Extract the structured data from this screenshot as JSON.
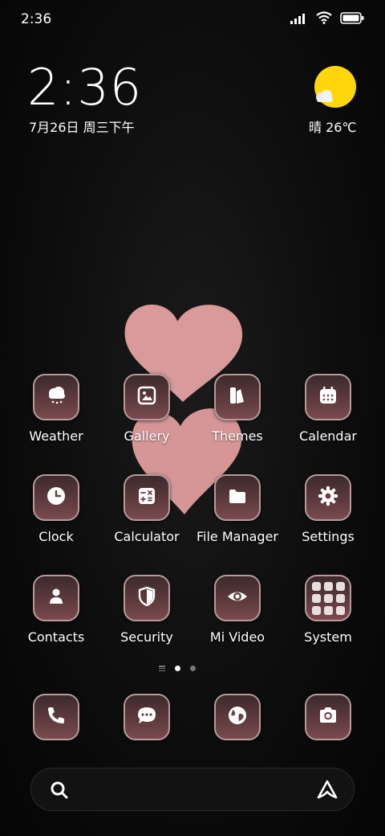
{
  "status_bar": {
    "time": "2:36"
  },
  "clock_widget": {
    "time": "2:36",
    "date": "7月26日 周三下午"
  },
  "weather_widget": {
    "text": "晴 26℃"
  },
  "apps": [
    {
      "label": "Weather",
      "icon": "weather-icon"
    },
    {
      "label": "Gallery",
      "icon": "gallery-icon"
    },
    {
      "label": "Themes",
      "icon": "themes-icon"
    },
    {
      "label": "Calendar",
      "icon": "calendar-icon"
    },
    {
      "label": "Clock",
      "icon": "clock-icon"
    },
    {
      "label": "Calculator",
      "icon": "calculator-icon"
    },
    {
      "label": "File Manager",
      "icon": "folder-icon"
    },
    {
      "label": "Settings",
      "icon": "gear-icon"
    },
    {
      "label": "Contacts",
      "icon": "contact-icon"
    },
    {
      "label": "Security",
      "icon": "shield-icon"
    },
    {
      "label": "Mi Video",
      "icon": "eye-icon"
    },
    {
      "label": "System",
      "icon": "folder-grid-icon"
    }
  ],
  "dock": [
    {
      "icon": "phone-icon"
    },
    {
      "icon": "chat-icon"
    },
    {
      "icon": "globe-icon"
    },
    {
      "icon": "camera-icon"
    }
  ],
  "pager": {
    "page_count": 2,
    "active_page": 1
  },
  "colors": {
    "icon_border": "#b69a9c",
    "heart": "#d79a9b",
    "sun": "#ffd60a"
  }
}
